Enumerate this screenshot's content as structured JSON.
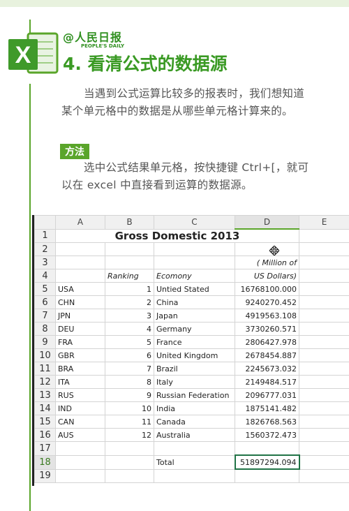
{
  "header": {
    "logo_text": "人民日报",
    "logo_subtext": "PEOPLE'S DAILY",
    "title": "4. 看清公式的数据源"
  },
  "intro": "当遇到公式运算比较多的报表时，我们想知道某个单元格中的数据是从哪些单元格计算来的。",
  "method": {
    "label": "方法",
    "text": "选中公式结果单元格，按快捷键 Ctrl+[，就可以在 excel 中直接看到运算的数据源。"
  },
  "spreadsheet": {
    "columns": [
      "A",
      "B",
      "C",
      "D",
      "E"
    ],
    "selected_column": "D",
    "selected_row": "18",
    "title": "Gross Domestic 2013",
    "unit_line1": "( Million of",
    "unit_line2": "US Dollars)",
    "ranking_header": "Ranking",
    "economy_header": "Ecomony",
    "rows": [
      {
        "code": "USA",
        "rank": "1",
        "name": "Untied Stated",
        "value": "16768100.000"
      },
      {
        "code": "CHN",
        "rank": "2",
        "name": "China",
        "value": "9240270.452"
      },
      {
        "code": "JPN",
        "rank": "3",
        "name": "Japan",
        "value": "4919563.108"
      },
      {
        "code": "DEU",
        "rank": "4",
        "name": "Germany",
        "value": "3730260.571"
      },
      {
        "code": "FRA",
        "rank": "5",
        "name": "France",
        "value": "2806427.978"
      },
      {
        "code": "GBR",
        "rank": "6",
        "name": "United Kingdom",
        "value": "2678454.887"
      },
      {
        "code": "BRA",
        "rank": "7",
        "name": "Brazil",
        "value": "2245673.032"
      },
      {
        "code": "ITA",
        "rank": "8",
        "name": "Italy",
        "value": "2149484.517"
      },
      {
        "code": "RUS",
        "rank": "9",
        "name": "Russian Federation",
        "value": "2096777.031"
      },
      {
        "code": "IND",
        "rank": "10",
        "name": "India",
        "value": "1875141.482"
      },
      {
        "code": "CAN",
        "rank": "11",
        "name": "Canada",
        "value": "1826768.563"
      },
      {
        "code": "AUS",
        "rank": "12",
        "name": "Australia",
        "value": "1560372.473"
      }
    ],
    "total_label": "Total",
    "total_value": "51897294.094",
    "row_numbers": [
      "1",
      "2",
      "3",
      "4",
      "5",
      "6",
      "7",
      "8",
      "9",
      "10",
      "11",
      "12",
      "13",
      "14",
      "15",
      "16",
      "17",
      "18",
      "19"
    ]
  },
  "colors": {
    "accent": "#5aa52a",
    "heading": "#3a9a24",
    "excel_green": "#217346"
  }
}
